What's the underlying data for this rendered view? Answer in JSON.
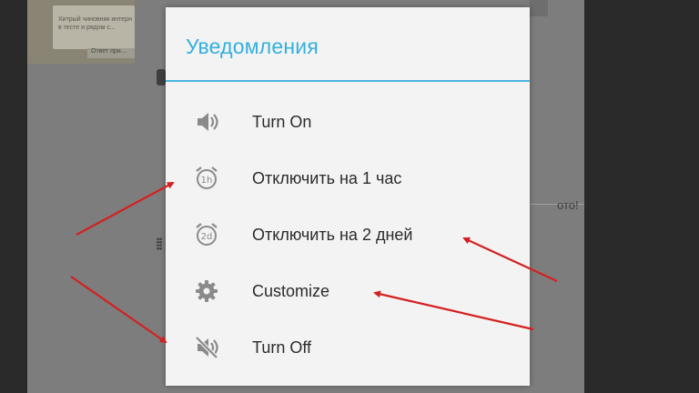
{
  "background": {
    "card_text": "Хитрый чиновник интерн в тесте и рядом с...",
    "reply_label": "Ответ при...",
    "right_text": "ото!"
  },
  "dialog": {
    "title": "Уведомления",
    "accent_color": "#33b0de",
    "items": [
      {
        "label": "Turn On",
        "icon": "speaker-on-icon"
      },
      {
        "label": "Отключить на 1 час",
        "icon": "alarm-1h-icon",
        "icon_text": "1h"
      },
      {
        "label": "Отключить на 2 дней",
        "icon": "alarm-2d-icon",
        "icon_text": "2d"
      },
      {
        "label": "Customize",
        "icon": "gear-icon"
      },
      {
        "label": "Turn Off",
        "icon": "speaker-muted-icon"
      }
    ]
  },
  "annotations": {
    "arrow_color": "#d42020"
  }
}
